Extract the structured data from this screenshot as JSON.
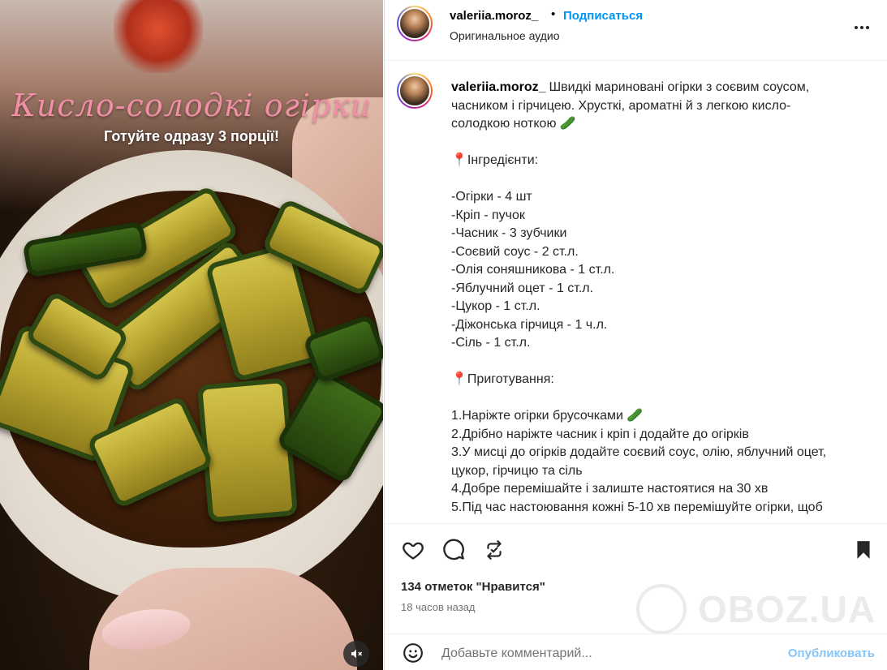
{
  "media": {
    "title": "Кисло-солодкі огірки",
    "subtitle": "Готуйте одразу 3 порції!",
    "mute_icon": "volume-muted-icon"
  },
  "header": {
    "username": "valeriia.moroz_",
    "dot": "•",
    "follow_label": "Подписаться",
    "audio_label": "Оригинальное аудио",
    "more_icon": "more-horizontal-icon"
  },
  "caption": {
    "username": "valeriia.moroz_",
    "intro": "Швидкі мариновані огірки з соєвим соусом, часником і гірчицею. Хрусткі, ароматні й з легкою кисло-солодкою ноткою 🥒",
    "ingredients_heading": "📍Інгредієнти:",
    "ingredients": [
      "-Огірки - 4 шт",
      "-Кріп - пучок",
      "-Часник - 3 зубчики",
      "-Соєвий соус - 2 ст.л.",
      "-Олія соняшникова - 1 ст.л.",
      "-Яблучний оцет - 1 ст.л.",
      "-Цукор - 1 ст.л.",
      "-Діжонська гірчиця - 1 ч.л.",
      "-Сіль - 1 ст.л."
    ],
    "steps_heading": "📍Приготування:",
    "steps": [
      "1.Наріжте огірки брусочками 🥒",
      "2.Дрібно наріжте часник і кріп і додайте до огірків",
      "3.У мисці до огірків додайте соєвий соус, олію, яблучний оцет, цукор, гірчицю та сіль",
      "4.Добре перемішайте і залиште настоятися на 30 хв",
      "5.Під час настоювання кожні 5-10 хв перемішуйте огірки, щоб"
    ]
  },
  "actions": {
    "like_icon": "heart-icon",
    "comment_icon": "comment-icon",
    "share_icon": "repost-icon",
    "save_icon": "bookmark-icon",
    "likes_text": "134 отметок \"Нравится\"",
    "time_text": "18 часов назад"
  },
  "comment": {
    "emoji_icon": "smiley-icon",
    "placeholder": "Добавьте комментарий...",
    "publish_label": "Опубликовать"
  },
  "watermark": {
    "text": "OBOZ.UA"
  },
  "colors": {
    "accent_blue": "#0095f6",
    "publish_disabled": "#86c5f9",
    "title_pink": "#f08fa6"
  }
}
